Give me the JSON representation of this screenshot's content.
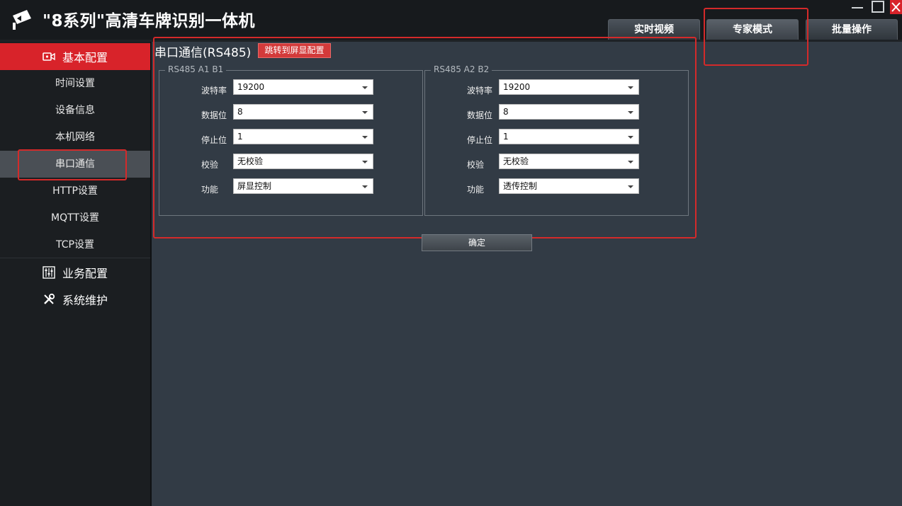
{
  "app": {
    "title": "\"8系列\"高清车牌识别一体机"
  },
  "tabs": [
    {
      "label": "实时视频"
    },
    {
      "label": "专家模式"
    },
    {
      "label": "批量操作"
    }
  ],
  "sidebar": {
    "sections": [
      {
        "label": "基本配置",
        "icon": "video-camera-icon"
      },
      {
        "label": "业务配置",
        "icon": "sliders-icon"
      },
      {
        "label": "系统维护",
        "icon": "wrench-icon"
      }
    ],
    "items": [
      {
        "label": "时间设置"
      },
      {
        "label": "设备信息"
      },
      {
        "label": "本机网络"
      },
      {
        "label": "串口通信"
      },
      {
        "label": "HTTP设置"
      },
      {
        "label": "MQTT设置"
      },
      {
        "label": "TCP设置"
      }
    ],
    "selected": "串口通信"
  },
  "panel": {
    "title": "串口通信(RS485)",
    "jump_button": "跳转到屏显配置",
    "ok_button": "确定"
  },
  "groups": [
    {
      "legend": "RS485  A1 B1",
      "fields": [
        {
          "label": "波特率",
          "value": "19200"
        },
        {
          "label": "数据位",
          "value": "8"
        },
        {
          "label": "停止位",
          "value": "1"
        },
        {
          "label": "校验",
          "value": "无校验"
        },
        {
          "label": "功能",
          "value": "屏显控制"
        }
      ]
    },
    {
      "legend": "RS485  A2 B2",
      "fields": [
        {
          "label": "波特率",
          "value": "19200"
        },
        {
          "label": "数据位",
          "value": "8"
        },
        {
          "label": "停止位",
          "value": "1"
        },
        {
          "label": "校验",
          "value": "无校验"
        },
        {
          "label": "功能",
          "value": "透传控制"
        }
      ]
    }
  ],
  "colors": {
    "accent": "#d8232a",
    "highlight_box": "#d42a2a",
    "background": "#323b45",
    "sidebar": "#1b1e21"
  }
}
